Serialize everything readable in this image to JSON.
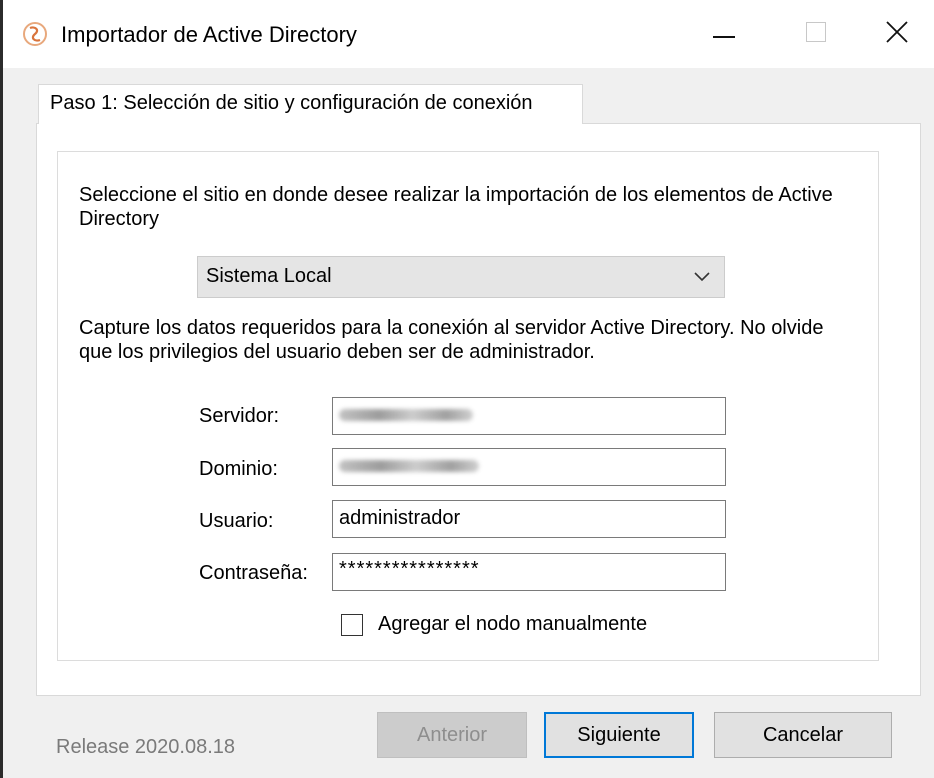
{
  "window": {
    "title": "Importador de Active Directory",
    "controls": {
      "minimize": "minimize-icon",
      "maximize": "maximize-icon",
      "close": "close-icon"
    }
  },
  "tab": {
    "label": "Paso 1: Selección de sitio y configuración de conexión"
  },
  "site": {
    "instruction": "Seleccione el sitio en donde desee realizar la importación de los elementos de Active Directory",
    "selected": "Sistema Local"
  },
  "connection": {
    "instruction": "Capture los datos requeridos para la conexión al servidor Active Directory. No olvide que los privilegios del usuario deben ser de administrador.",
    "fields": [
      {
        "label": "Servidor:",
        "value": ""
      },
      {
        "label": "Dominio:",
        "value": ""
      },
      {
        "label": "Usuario:",
        "value": "administrador"
      },
      {
        "label": "Contraseña:",
        "value": "****************"
      }
    ],
    "manual_node": {
      "label": "Agregar el nodo manualmente",
      "checked": false
    }
  },
  "footer": {
    "release": "Release 2020.08.18",
    "prev_label": "Anterior",
    "next_label": "Siguiente",
    "cancel_label": "Cancelar"
  },
  "colors": {
    "accent": "#0078d7",
    "disabled_text": "#8e8e8e",
    "background": "#f0f0f0"
  }
}
